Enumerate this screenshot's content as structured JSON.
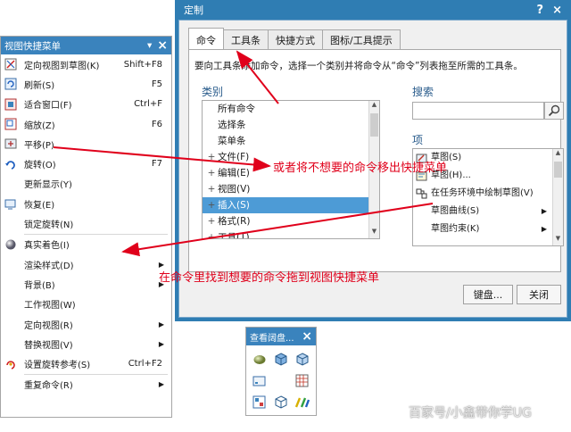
{
  "customize_dialog": {
    "title": "定制",
    "help": "?",
    "close": "×",
    "tabs": [
      "命令",
      "工具条",
      "快捷方式",
      "图标/工具提示"
    ],
    "instruction": "要向工具条添加命令，选择一个类别并将命令从“命令”列表拖至所需的工具条。",
    "categories_label": "类别",
    "categories": [
      {
        "label": "所有命令",
        "expander": ""
      },
      {
        "label": "选择条",
        "expander": ""
      },
      {
        "label": "菜单条",
        "expander": ""
      },
      {
        "label": "文件(F)",
        "expander": "+"
      },
      {
        "label": "编辑(E)",
        "expander": "+"
      },
      {
        "label": "视图(V)",
        "expander": "+"
      },
      {
        "label": "插入(S)",
        "expander": "+"
      },
      {
        "label": "格式(R)",
        "expander": "+"
      },
      {
        "label": "工具(T)",
        "expander": "+"
      }
    ],
    "selected_category": "插入(S)",
    "search_label": "搜索",
    "search_value": "",
    "items_label": "项",
    "items": [
      {
        "label": "草图(S)",
        "icon": "sketch-icon",
        "submenu": false
      },
      {
        "label": "草图(H)...",
        "icon": "sketch-in-place-icon",
        "submenu": false
      },
      {
        "label": "在任务环境中绘制草图(V)",
        "icon": "task-sketch-icon",
        "submenu": false
      },
      {
        "label": "草图曲线(S)",
        "icon": "",
        "submenu": true
      },
      {
        "label": "草图约束(K)",
        "icon": "",
        "submenu": true
      }
    ],
    "keyboard_button": "键盘...",
    "close_button": "关闭"
  },
  "shortcut_menu": {
    "title": "视图快捷菜单",
    "pin": "▾",
    "close": "×",
    "items": [
      {
        "label": "定向视图到草图(K)",
        "shortcut": "Shift+F8",
        "icon": "orient-to-sketch-icon",
        "submenu": false
      },
      {
        "label": "刷新(S)",
        "shortcut": "F5",
        "icon": "refresh-icon",
        "submenu": false
      },
      {
        "label": "适合窗口(F)",
        "shortcut": "Ctrl+F",
        "icon": "fit-window-icon",
        "submenu": false
      },
      {
        "label": "缩放(Z)",
        "shortcut": "F6",
        "icon": "zoom-icon",
        "submenu": false
      },
      {
        "label": "平移(P)",
        "shortcut": "",
        "icon": "pan-icon",
        "submenu": false
      },
      {
        "label": "旋转(O)",
        "shortcut": "F7",
        "icon": "rotate-icon",
        "submenu": false
      },
      {
        "label": "更新显示(Y)",
        "shortcut": "",
        "icon": "",
        "submenu": false
      },
      {
        "label": "恢复(E)",
        "shortcut": "",
        "icon": "restore-icon",
        "submenu": false
      },
      {
        "label": "锁定旋转(N)",
        "shortcut": "",
        "icon": "",
        "submenu": false
      },
      {
        "separator": true
      },
      {
        "label": "真实着色(I)",
        "shortcut": "",
        "icon": "true-shading-icon",
        "submenu": false
      },
      {
        "label": "渲染样式(D)",
        "shortcut": "",
        "icon": "",
        "submenu": true
      },
      {
        "label": "背景(B)",
        "shortcut": "",
        "icon": "",
        "submenu": true
      },
      {
        "label": "工作视图(W)",
        "shortcut": "",
        "icon": "",
        "submenu": false
      },
      {
        "label": "定向视图(R)",
        "shortcut": "",
        "icon": "",
        "submenu": true
      },
      {
        "label": "替换视图(V)",
        "shortcut": "",
        "icon": "",
        "submenu": true
      },
      {
        "label": "设置旋转参考(S)",
        "shortcut": "Ctrl+F2",
        "icon": "set-rotate-ref-icon",
        "submenu": false
      },
      {
        "separator": true
      },
      {
        "label": "重复命令(R)",
        "shortcut": "",
        "icon": "",
        "submenu": true
      }
    ]
  },
  "quick_toolbar": {
    "title": "查看阔盘...",
    "close": "×",
    "icons": [
      "shaded-sphere-icon",
      "cube-blue-icon",
      "cube-light-icon",
      "view-frame-icon",
      "",
      "sketch-grid-icon",
      "grid-layout-icon",
      "wire-cube-icon",
      "color-tools-icon"
    ]
  },
  "annotations": {
    "top": "或者将不想要的命令移出快捷菜单",
    "bottom": "在命令里找到想要的命令拖到视图快捷菜单"
  },
  "watermark": "百家号/小鑫带你学UG",
  "colors": {
    "title_bar": "#3a83bd",
    "dialog_frame": "#2f7db3",
    "selection": "#4d9bd6",
    "annotation": "#e0001b"
  }
}
